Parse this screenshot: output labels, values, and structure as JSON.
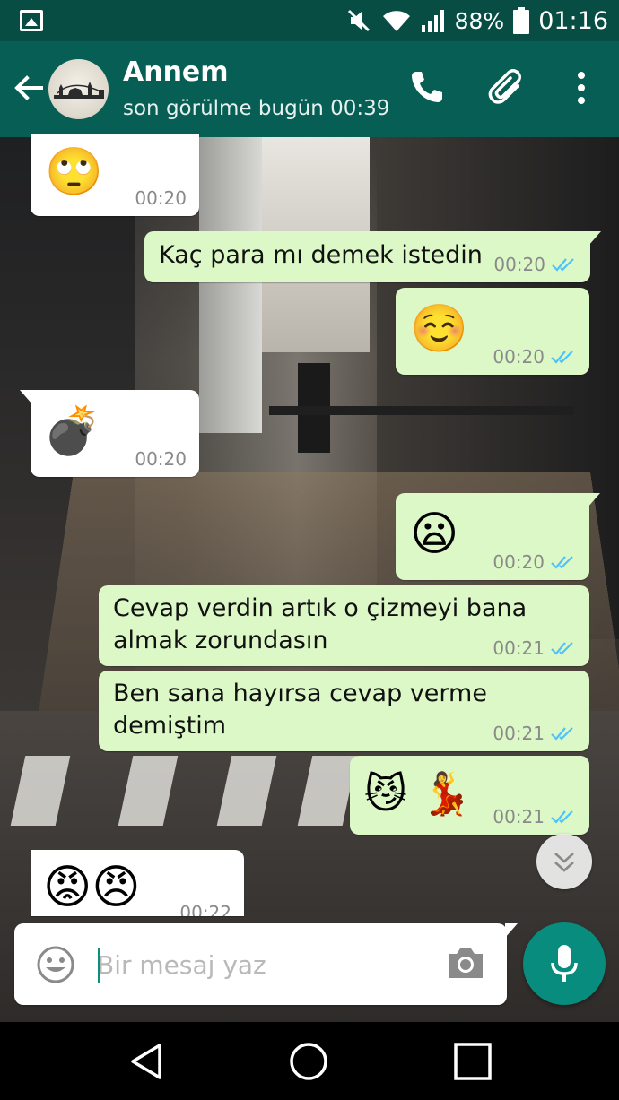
{
  "status_bar": {
    "battery": "88%",
    "time": "01:16",
    "icons": [
      "gallery-icon",
      "mute-icon",
      "wifi-icon",
      "signal-icon",
      "battery-icon"
    ]
  },
  "header": {
    "contact_name": "Annem",
    "last_seen": "son görülme bugün 00:39",
    "icons": [
      "back-arrow-icon",
      "avatar",
      "phone-icon",
      "paperclip-icon",
      "more-vert-icon"
    ]
  },
  "messages": [
    {
      "direction": "in",
      "content": "🙄",
      "time": "00:20"
    },
    {
      "direction": "out",
      "content": "Kaç para mı demek istedin",
      "time": "00:20",
      "read": true
    },
    {
      "direction": "out",
      "content": "☺️",
      "time": "00:20",
      "read": true
    },
    {
      "direction": "in",
      "content": "💣",
      "time": "00:20"
    },
    {
      "direction": "out",
      "content": "😦",
      "time": "00:20",
      "read": true
    },
    {
      "direction": "out",
      "content_line1": "Cevap verdin artık o çizmeyi bana",
      "content_line2": "almak zorundasın",
      "time": "00:21",
      "read": true
    },
    {
      "direction": "out",
      "content_line1": "Ben sana hayırsa cevap verme",
      "content_line2": "demiştim",
      "time": "00:21",
      "read": true
    },
    {
      "direction": "out",
      "content": "😼 💃",
      "time": "00:21",
      "read": true
    },
    {
      "direction": "in",
      "content": "😡😠",
      "time": "00:22"
    }
  ],
  "composer": {
    "placeholder": "Bir mesaj yaz",
    "icons": [
      "emoji-icon",
      "camera-icon",
      "mic-icon"
    ]
  },
  "colors": {
    "status_bar": "#084d43",
    "app_bar": "#075e54",
    "outgoing_bubble": "#dcf8c6",
    "incoming_bubble": "#ffffff",
    "read_ticks": "#4fc3f7",
    "fab": "#078c7e"
  }
}
